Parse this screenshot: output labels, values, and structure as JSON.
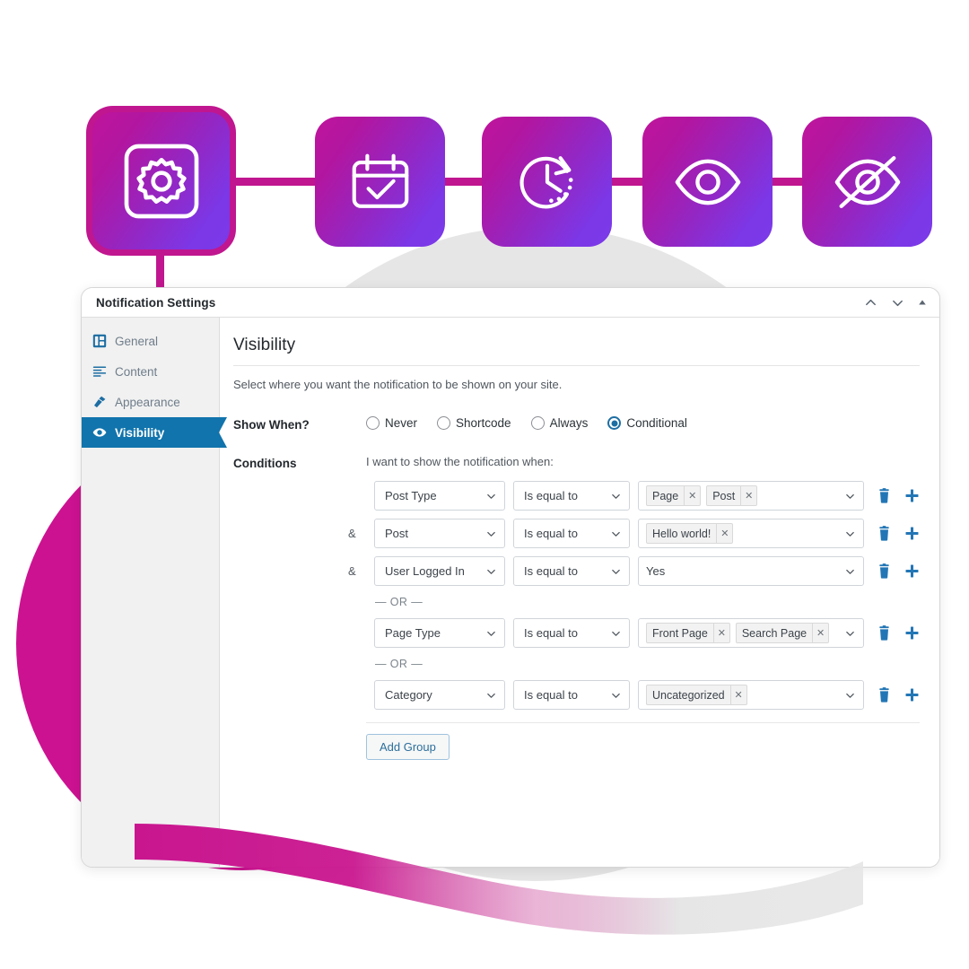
{
  "theme": {
    "tile_gradient_from": "#c0149c",
    "tile_gradient_to": "#7a3ae9",
    "tile_border": "#c0168f",
    "accent_blue": "#1174ac",
    "link_blue": "#2376b5",
    "magenta_circle": "#cc1291",
    "gray_circle": "#e6e6e6"
  },
  "tiles": [
    {
      "name": "settings-gear-tile",
      "icon": "gear-in-square-icon",
      "active": true
    },
    {
      "name": "schedule-calendar-tile",
      "icon": "calendar-check-icon",
      "active": false
    },
    {
      "name": "recurring-clock-tile",
      "icon": "clock-arrow-icon",
      "active": false
    },
    {
      "name": "visible-eye-tile",
      "icon": "eye-icon",
      "active": false
    },
    {
      "name": "hidden-eye-tile",
      "icon": "eye-off-icon",
      "active": false
    }
  ],
  "window": {
    "title": "Notification Settings",
    "controls": [
      {
        "name": "chevron-up-icon",
        "label": "Move up"
      },
      {
        "name": "chevron-down-icon",
        "label": "Move down"
      },
      {
        "name": "collapse-triangle-icon",
        "label": "Collapse"
      }
    ]
  },
  "sidebar": {
    "items": [
      {
        "label": "General",
        "icon": "dashboard-icon",
        "active": false
      },
      {
        "label": "Content",
        "icon": "list-lines-icon",
        "active": false
      },
      {
        "label": "Appearance",
        "icon": "brush-icon",
        "active": false
      },
      {
        "label": "Visibility",
        "icon": "eye-icon",
        "active": true
      }
    ]
  },
  "panel": {
    "title": "Visibility",
    "description": "Select where you want the notification to be shown on your site.",
    "show_when": {
      "label": "Show When?",
      "options": [
        {
          "label": "Never",
          "selected": false
        },
        {
          "label": "Shortcode",
          "selected": false
        },
        {
          "label": "Always",
          "selected": false
        },
        {
          "label": "Conditional",
          "selected": true
        }
      ]
    },
    "conditions": {
      "label": "Conditions",
      "intro": "I want to show the notification when:",
      "or_separator": "— OR —",
      "add_group_label": "Add Group",
      "row_actions": [
        {
          "name": "delete-row-icon",
          "label": "Delete"
        },
        {
          "name": "add-row-icon",
          "label": "Add"
        }
      ],
      "groups": [
        {
          "rows": [
            {
              "conjunction": "",
              "field": "Post Type",
              "operator": "Is equal to",
              "chips": [
                "Page",
                "Post"
              ],
              "plain_value": ""
            },
            {
              "conjunction": "&",
              "field": "Post",
              "operator": "Is equal to",
              "chips": [
                "Hello world!"
              ],
              "plain_value": ""
            },
            {
              "conjunction": "&",
              "field": "User Logged In",
              "operator": "Is equal to",
              "chips": [],
              "plain_value": "Yes"
            }
          ]
        },
        {
          "rows": [
            {
              "conjunction": "",
              "field": "Page Type",
              "operator": "Is equal to",
              "chips": [
                "Front Page",
                "Search Page"
              ],
              "plain_value": ""
            }
          ]
        },
        {
          "rows": [
            {
              "conjunction": "",
              "field": "Category",
              "operator": "Is equal to",
              "chips": [
                "Uncategorized"
              ],
              "plain_value": ""
            }
          ]
        }
      ]
    }
  }
}
